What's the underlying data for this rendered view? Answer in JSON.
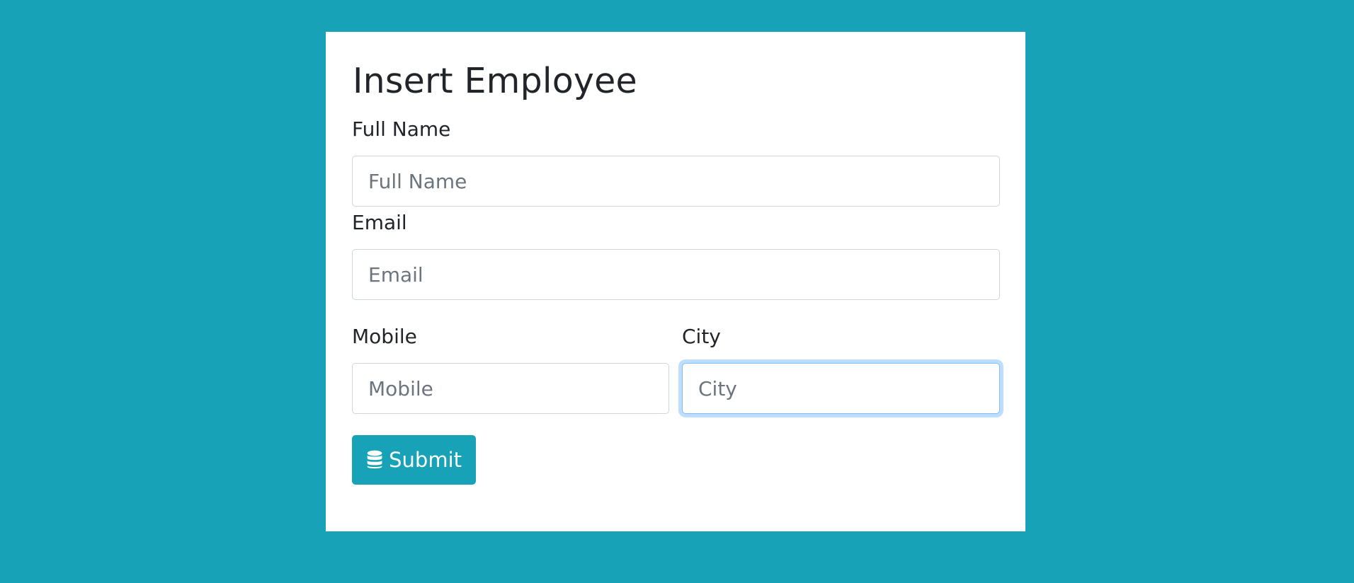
{
  "form": {
    "title": "Insert Employee",
    "full_name": {
      "label": "Full Name",
      "placeholder": "Full Name",
      "value": ""
    },
    "email": {
      "label": "Email",
      "placeholder": "Email",
      "value": ""
    },
    "mobile": {
      "label": "Mobile",
      "placeholder": "Mobile",
      "value": ""
    },
    "city": {
      "label": "City",
      "placeholder": "City",
      "value": "",
      "focused": true
    },
    "submit": {
      "label": "Submit",
      "icon": "database-icon"
    }
  },
  "colors": {
    "background": "#17a2b8",
    "card": "#ffffff",
    "button": "#17a2b8",
    "focus_ring": "#80bdff",
    "text": "#212529",
    "placeholder": "#6c757d"
  }
}
